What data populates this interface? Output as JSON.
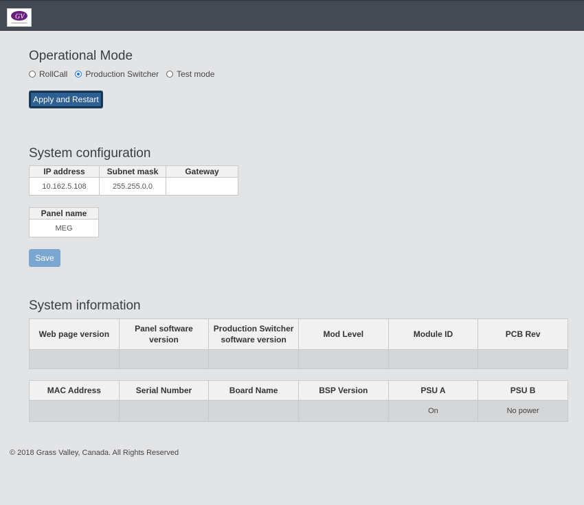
{
  "header": {
    "logo_icon": "grass-valley-logo-icon",
    "background": "#434a54"
  },
  "operational_mode": {
    "title": "Operational Mode",
    "options": [
      {
        "label": "RollCall",
        "selected": false
      },
      {
        "label": "Production Switcher",
        "selected": true
      },
      {
        "label": "Test mode",
        "selected": false
      }
    ],
    "apply_label": "Apply and Restart"
  },
  "system_config": {
    "title": "System configuration",
    "ip_header": "IP address",
    "subnet_header": "Subnet mask",
    "gateway_header": "Gateway",
    "ip_value": "10.162.5.108",
    "subnet_value": "255.255.0.0",
    "gateway_value": "",
    "panel_name_header": "Panel name",
    "panel_name_value": "MEG",
    "save_label": "Save"
  },
  "system_info": {
    "title": "System information",
    "table1": {
      "headers": [
        "Web page version",
        "Panel software version",
        "Production Switcher software version",
        "Mod Level",
        "Module ID",
        "PCB Rev"
      ],
      "values": [
        "",
        "",
        "",
        "",
        "",
        ""
      ]
    },
    "table2": {
      "headers": [
        "MAC Address",
        "Serial Number",
        "Board Name",
        "BSP Version",
        "PSU A",
        "PSU B"
      ],
      "values": [
        "",
        "",
        "",
        "",
        "On",
        "No power"
      ]
    }
  },
  "footer": {
    "text": "© 2018 Grass Valley, Canada. All Rights Reserved"
  },
  "colors": {
    "accent": "#2d5f93",
    "save": "#7aa6cf",
    "logo": "#6b1f7c"
  }
}
